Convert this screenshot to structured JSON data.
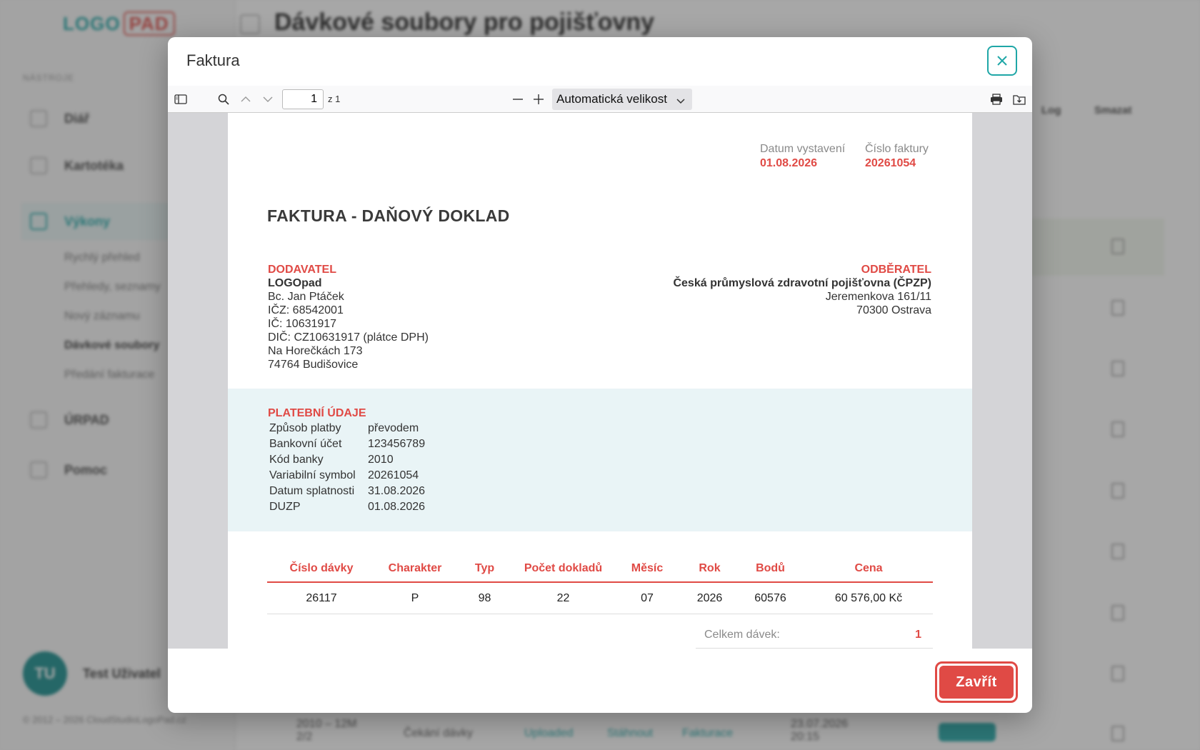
{
  "app": {
    "page_title": "Dávkové soubory pro pojišťovny",
    "logo_part1": "LOGO",
    "logo_part2": "PAD",
    "section_label": "NÁSTROJE",
    "nav": [
      {
        "label": "Diář"
      },
      {
        "label": "Kartotéka"
      },
      {
        "label": "Výkony"
      },
      {
        "label": "ÚRPAD"
      },
      {
        "label": "Pomoc"
      }
    ],
    "subnav": [
      "Rychlý přehled",
      "Přehledy, seznamy",
      "Nový záznamu",
      "Dávkové soubory",
      "Předání fakturace"
    ],
    "user_initials": "TU",
    "user_name": "Test Uživatel",
    "copyright": "© 2012 – 2026 CloudStudioLogoPad.cz",
    "columns": [
      "Log",
      "Smazat"
    ],
    "bottom_row": {
      "period": "2010 – 12M",
      "period2": "2/2",
      "status": "Čekání dávky",
      "link1": "Uploaded",
      "link2": "Stáhnout",
      "link3": "Fakturace",
      "date": "23.07.2026",
      "date2": "20:15"
    }
  },
  "modal": {
    "title": "Faktura",
    "close_label": "Zavřít",
    "viewer": {
      "page_value": "1",
      "page_of": "z 1",
      "zoom": "Automatická velikost"
    },
    "invoice": {
      "issue_date_label": "Datum vystavení",
      "issue_date": "01.08.2026",
      "invoice_no_label": "Číslo faktury",
      "invoice_no": "20261054",
      "doc_title": "FAKTURA - DAŇOVÝ DOKLAD",
      "supplier": {
        "heading": "DODAVATEL",
        "name": "LOGOpad",
        "lines": [
          "Bc. Jan Ptáček",
          "IČZ: 68542001",
          "IČ: 10631917",
          "DIČ: CZ10631917 (plátce DPH)",
          "Na Horečkách 173",
          "74764 Budišovice"
        ]
      },
      "customer": {
        "heading": "ODBĚRATEL",
        "name": "Česká průmyslová zdravotní pojišťovna (ČPZP)",
        "lines": [
          "Jeremenkova 161/11",
          "70300 Ostrava"
        ]
      },
      "payment": {
        "heading": "PLATEBNÍ ÚDAJE",
        "rows": [
          {
            "k": "Způsob platby",
            "v": "převodem"
          },
          {
            "k": "Bankovní účet",
            "v": "123456789"
          },
          {
            "k": "Kód banky",
            "v": "2010"
          },
          {
            "k": "Variabilní symbol",
            "v": "20261054"
          },
          {
            "k": "Datum splatnosti",
            "v": "31.08.2026"
          },
          {
            "k": "DUZP",
            "v": "01.08.2026"
          }
        ]
      },
      "table": {
        "headers": [
          "Číslo dávky",
          "Charakter",
          "Typ",
          "Počet dokladů",
          "Měsíc",
          "Rok",
          "Bodů",
          "Cena"
        ],
        "rows": [
          [
            "26117",
            "P",
            "98",
            "22",
            "07",
            "2026",
            "60576",
            "60 576,00 Kč"
          ]
        ]
      },
      "totals": {
        "label": "Celkem dávek:",
        "value": "1"
      }
    }
  },
  "colors": {
    "accent": "#1fa7a7",
    "brand_red": "#e04a45",
    "payment_bg": "#e9f4f6"
  }
}
